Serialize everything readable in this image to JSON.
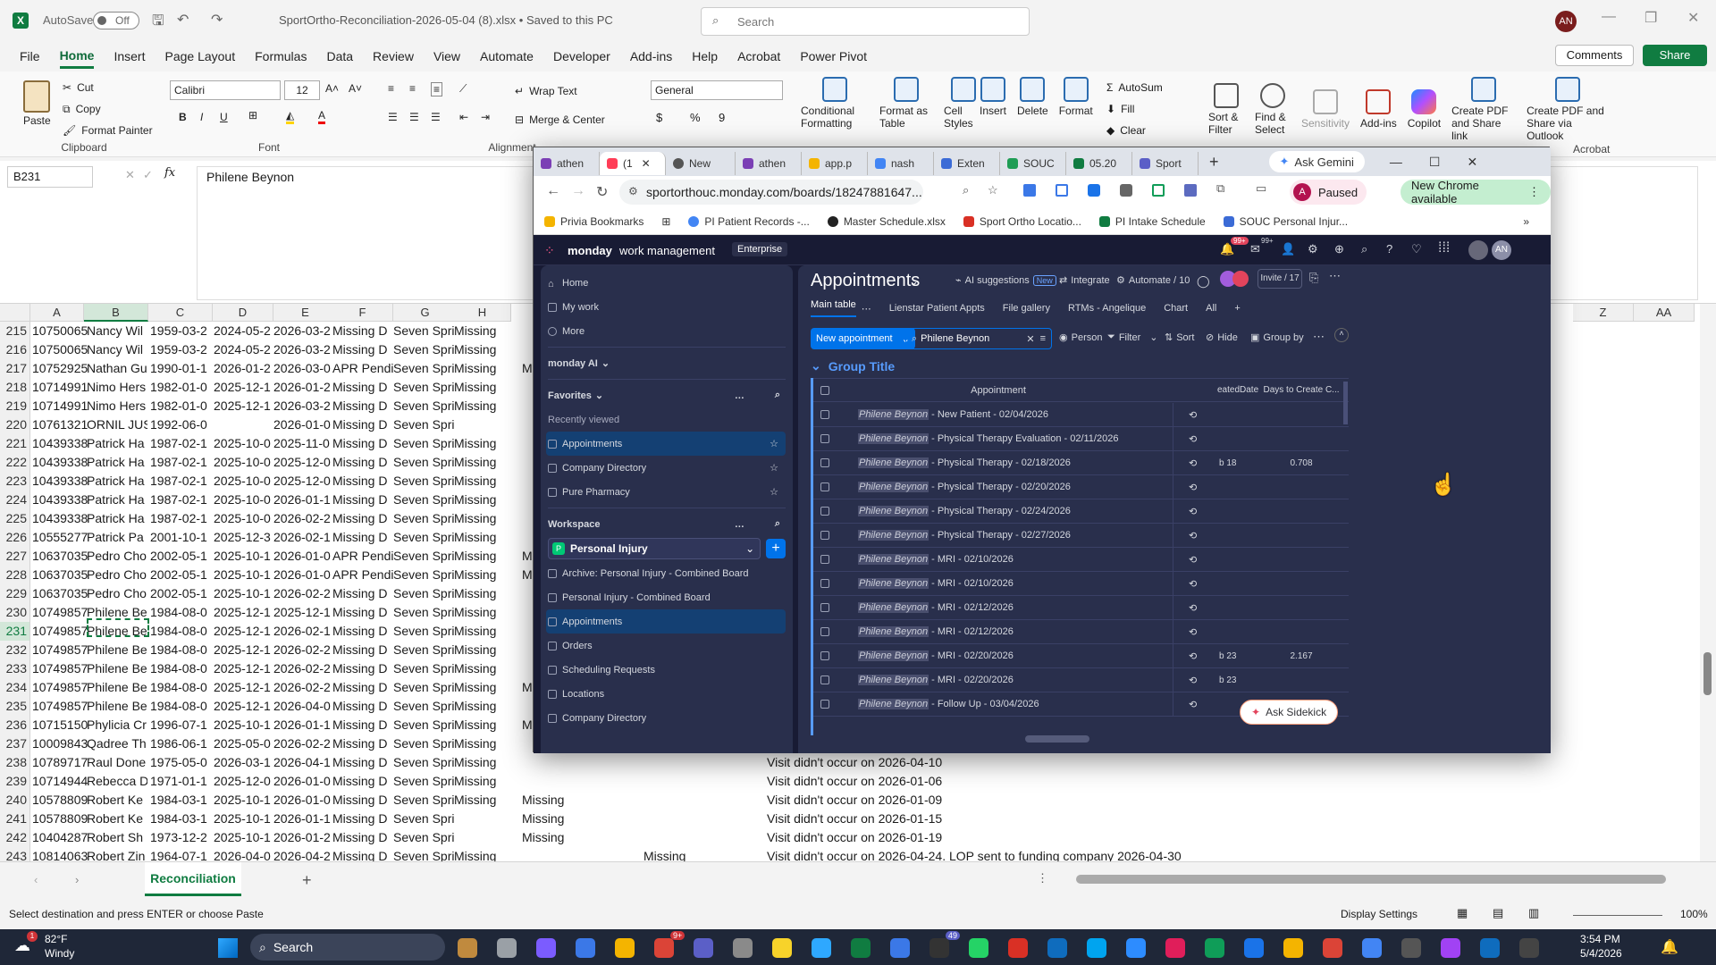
{
  "excel": {
    "autosave": "AutoSave",
    "autosave_state": "Off",
    "filename": "SportOrtho-Reconciliation-2026-05-04 (8).xlsx • Saved to this PC",
    "search_placeholder": "Search",
    "user": "AN",
    "menu": [
      "File",
      "Home",
      "Insert",
      "Page Layout",
      "Formulas",
      "Data",
      "Review",
      "View",
      "Automate",
      "Developer",
      "Add-ins",
      "Help",
      "Acrobat",
      "Power Pivot"
    ],
    "comments": "Comments",
    "share": "Share",
    "ribbon": {
      "paste": "Paste",
      "cut": "Cut",
      "copy": "Copy",
      "format_painter": "Format Painter",
      "clipboard": "Clipboard",
      "font_name": "Calibri",
      "font_size": "12",
      "font": "Font",
      "wrap": "Wrap Text",
      "merge": "Merge & Center",
      "alignment": "Alignment",
      "number_format": "General",
      "cond_fmt": "Conditional Formatting",
      "fmt_table": "Format as Table",
      "cell_styles": "Cell Styles",
      "insert": "Insert",
      "delete": "Delete",
      "format": "Format",
      "autosum": "AutoSum",
      "fill": "Fill",
      "clear": "Clear",
      "sort": "Sort & Filter",
      "find": "Find & Select",
      "sensitivity": "Sensitivity",
      "addins": "Add-ins",
      "copilot": "Copilot",
      "pdf1": "Create PDF and Share link",
      "pdf2": "Create PDF and Share via Outlook",
      "acrobat": "Acrobat"
    },
    "namebox": "B231",
    "formula": "Philene Beynon",
    "col_headers": [
      "A",
      "B",
      "C",
      "D",
      "E",
      "F",
      "G",
      "H"
    ],
    "col_headers_right": [
      "Z",
      "AA"
    ],
    "rows": [
      {
        "n": "215",
        "a": "10750065",
        "b": "Nancy Wil",
        "c": "1959-03-2",
        "d": "2024-05-2",
        "e": "2026-03-2",
        "f": "Missing D",
        "g": "Seven Spri",
        "h": "Missing",
        "i": "",
        "j": "",
        "k": ""
      },
      {
        "n": "216",
        "a": "10750065",
        "b": "Nancy Wil",
        "c": "1959-03-2",
        "d": "2024-05-2",
        "e": "2026-03-2",
        "f": "Missing D",
        "g": "Seven Spri",
        "h": "Missing",
        "i": "",
        "j": "",
        "k": ""
      },
      {
        "n": "217",
        "a": "10752925",
        "b": "Nathan Gu",
        "c": "1990-01-1",
        "d": "2026-01-2",
        "e": "2026-03-0",
        "f": "APR Pendi",
        "g": "Seven Spri",
        "h": "Missing",
        "i": "M",
        "j": "",
        "k": ""
      },
      {
        "n": "218",
        "a": "10714991",
        "b": "Nimo Hers",
        "c": "1982-01-0",
        "d": "2025-12-1",
        "e": "2026-01-2",
        "f": "Missing D",
        "g": "Seven Spri",
        "h": "Missing",
        "i": "",
        "j": "",
        "k": ""
      },
      {
        "n": "219",
        "a": "10714991",
        "b": "Nimo Hers",
        "c": "1982-01-0",
        "d": "2025-12-1",
        "e": "2026-03-2",
        "f": "Missing D",
        "g": "Seven Spri",
        "h": "Missing",
        "i": "",
        "j": "",
        "k": ""
      },
      {
        "n": "220",
        "a": "10761321",
        "b": "ORNIL JUS",
        "c": "1992-06-0",
        "d": "",
        "e": "2026-01-0",
        "f": "Missing D",
        "g": "Seven Spri",
        "h": "",
        "i": "",
        "j": "",
        "k": ""
      },
      {
        "n": "221",
        "a": "10439338",
        "b": "Patrick Ha",
        "c": "1987-02-1",
        "d": "2025-10-0",
        "e": "2025-11-0",
        "f": "Missing D",
        "g": "Seven Spri",
        "h": "Missing",
        "i": "",
        "j": "",
        "k": ""
      },
      {
        "n": "222",
        "a": "10439338",
        "b": "Patrick Ha",
        "c": "1987-02-1",
        "d": "2025-10-0",
        "e": "2025-12-0",
        "f": "Missing D",
        "g": "Seven Spri",
        "h": "Missing",
        "i": "",
        "j": "",
        "k": ""
      },
      {
        "n": "223",
        "a": "10439338",
        "b": "Patrick Ha",
        "c": "1987-02-1",
        "d": "2025-10-0",
        "e": "2025-12-0",
        "f": "Missing D",
        "g": "Seven Spri",
        "h": "Missing",
        "i": "",
        "j": "",
        "k": ""
      },
      {
        "n": "224",
        "a": "10439338",
        "b": "Patrick Ha",
        "c": "1987-02-1",
        "d": "2025-10-0",
        "e": "2026-01-1",
        "f": "Missing D",
        "g": "Seven Spri",
        "h": "Missing",
        "i": "",
        "j": "",
        "k": ""
      },
      {
        "n": "225",
        "a": "10439338",
        "b": "Patrick Ha",
        "c": "1987-02-1",
        "d": "2025-10-0",
        "e": "2026-02-2",
        "f": "Missing D",
        "g": "Seven Spri",
        "h": "Missing",
        "i": "",
        "j": "",
        "k": ""
      },
      {
        "n": "226",
        "a": "10555277",
        "b": "Patrick Pa",
        "c": "2001-10-1",
        "d": "2025-12-3",
        "e": "2026-02-1",
        "f": "Missing D",
        "g": "Seven Spri",
        "h": "Missing",
        "i": "",
        "j": "",
        "k": ""
      },
      {
        "n": "227",
        "a": "10637035",
        "b": "Pedro Cho",
        "c": "2002-05-1",
        "d": "2025-10-1",
        "e": "2026-01-0",
        "f": "APR Pendi",
        "g": "Seven Spri",
        "h": "Missing",
        "i": "M",
        "j": "",
        "k": ""
      },
      {
        "n": "228",
        "a": "10637035",
        "b": "Pedro Cho",
        "c": "2002-05-1",
        "d": "2025-10-1",
        "e": "2026-01-0",
        "f": "APR Pendi",
        "g": "Seven Spri",
        "h": "Missing",
        "i": "M",
        "j": "",
        "k": ""
      },
      {
        "n": "229",
        "a": "10637035",
        "b": "Pedro Cho",
        "c": "2002-05-1",
        "d": "2025-10-1",
        "e": "2026-02-2",
        "f": "Missing D",
        "g": "Seven Spri",
        "h": "Missing",
        "i": "",
        "j": "",
        "k": ""
      },
      {
        "n": "230",
        "a": "10749857",
        "b": "Philene Be",
        "c": "1984-08-0",
        "d": "2025-12-1",
        "e": "2025-12-1",
        "f": "Missing D",
        "g": "Seven Spri",
        "h": "Missing",
        "i": "",
        "j": "",
        "k": ""
      },
      {
        "n": "231",
        "a": "10749857",
        "b": "Philene Be",
        "c": "1984-08-0",
        "d": "2025-12-1",
        "e": "2026-02-1",
        "f": "Missing D",
        "g": "Seven Spri",
        "h": "Missing",
        "i": "",
        "j": "",
        "k": ""
      },
      {
        "n": "232",
        "a": "10749857",
        "b": "Philene Be",
        "c": "1984-08-0",
        "d": "2025-12-1",
        "e": "2026-02-2",
        "f": "Missing D",
        "g": "Seven Spri",
        "h": "Missing",
        "i": "",
        "j": "",
        "k": ""
      },
      {
        "n": "233",
        "a": "10749857",
        "b": "Philene Be",
        "c": "1984-08-0",
        "d": "2025-12-1",
        "e": "2026-02-2",
        "f": "Missing D",
        "g": "Seven Spri",
        "h": "Missing",
        "i": "",
        "j": "",
        "k": ""
      },
      {
        "n": "234",
        "a": "10749857",
        "b": "Philene Be",
        "c": "1984-08-0",
        "d": "2025-12-1",
        "e": "2026-02-2",
        "f": "Missing D",
        "g": "Seven Spri",
        "h": "Missing",
        "i": "M",
        "j": "",
        "k": ""
      },
      {
        "n": "235",
        "a": "10749857",
        "b": "Philene Be",
        "c": "1984-08-0",
        "d": "2025-12-1",
        "e": "2026-04-0",
        "f": "Missing D",
        "g": "Seven Spri",
        "h": "Missing",
        "i": "",
        "j": "",
        "k": ""
      },
      {
        "n": "236",
        "a": "10715150",
        "b": "Phylicia Cr",
        "c": "1996-07-1",
        "d": "2025-10-1",
        "e": "2026-01-1",
        "f": "Missing D",
        "g": "Seven Spri",
        "h": "Missing",
        "i": "M",
        "j": "",
        "k": ""
      },
      {
        "n": "237",
        "a": "10009843",
        "b": "Qadree Th",
        "c": "1986-06-1",
        "d": "2025-05-0",
        "e": "2026-02-2",
        "f": "Missing D",
        "g": "Seven Spri",
        "h": "Missing",
        "i": "",
        "j": "",
        "k": ""
      },
      {
        "n": "238",
        "a": "10789717",
        "b": "Raul Done",
        "c": "1975-05-0",
        "d": "2026-03-1",
        "e": "2026-04-1",
        "f": "Missing D",
        "g": "Seven Spri",
        "h": "Missing",
        "i": "",
        "j": "",
        "k": "Visit didn't occur on 2026-04-10"
      },
      {
        "n": "239",
        "a": "10714944",
        "b": "Rebecca D",
        "c": "1971-01-1",
        "d": "2025-12-0",
        "e": "2026-01-0",
        "f": "Missing D",
        "g": "Seven Spri",
        "h": "Missing",
        "i": "",
        "j": "",
        "k": "Visit didn't occur on 2026-01-06"
      },
      {
        "n": "240",
        "a": "10578809",
        "b": "Robert Ke",
        "c": "1984-03-1",
        "d": "2025-10-1",
        "e": "2026-01-0",
        "f": "Missing D",
        "g": "Seven Spri",
        "h": "Missing",
        "i": "Missing",
        "j": "",
        "k": "Visit didn't occur on 2026-01-09"
      },
      {
        "n": "241",
        "a": "10578809",
        "b": "Robert Ke",
        "c": "1984-03-1",
        "d": "2025-10-1",
        "e": "2026-01-1",
        "f": "Missing D",
        "g": "Seven Spri",
        "h": "",
        "i": "Missing",
        "j": "",
        "k": "Visit didn't occur on 2026-01-15"
      },
      {
        "n": "242",
        "a": "10404287",
        "b": "Robert Sh",
        "c": "1973-12-2",
        "d": "2025-10-1",
        "e": "2026-01-2",
        "f": "Missing D",
        "g": "Seven Spri",
        "h": "",
        "i": "Missing",
        "j": "",
        "k": "Visit didn't occur on 2026-01-19"
      },
      {
        "n": "243",
        "a": "10814063",
        "b": "Robert Zin",
        "c": "1964-07-1",
        "d": "2026-04-0",
        "e": "2026-04-2",
        "f": "Missing D",
        "g": "Seven Spri",
        "h": "Missing",
        "i": "",
        "j": "Missing",
        "k": "Visit didn't occur on 2026-04-24. LOP sent to funding company 2026-04-30"
      }
    ],
    "sheet_tab": "Reconciliation",
    "status_left": "Select destination and press ENTER or choose Paste",
    "display_settings": "Display Settings",
    "zoom": "100%"
  },
  "chrome": {
    "tabs": [
      "athen",
      "(1",
      "New",
      "athen",
      "app.p",
      "nash",
      "Exten",
      "SOUC",
      "05.20",
      "Sport"
    ],
    "ask_gemini": "Ask Gemini",
    "url": "sportorthouc.monday.com/boards/18247881647...",
    "profile_state": "Paused",
    "update": "New Chrome available",
    "bookmarks": [
      "Privia Bookmarks",
      "PI Patient Records -...",
      "Master Schedule.xlsx",
      "Sport Ortho Locatio...",
      "PI Intake Schedule",
      "SOUC Personal Injur..."
    ]
  },
  "monday": {
    "brand": "monday",
    "brand_sub": "work management",
    "plan": "Enterprise",
    "notif_count": "99+",
    "inbox_count": "99+",
    "avatar": "AN",
    "side": {
      "home": "Home",
      "mywork": "My work",
      "more": "More",
      "ai": "monday AI",
      "favorites": "Favorites",
      "recent": "Recently viewed",
      "recent_items": [
        "Appointments",
        "Company Directory",
        "Pure Pharmacy"
      ],
      "workspace": "Workspace",
      "workspace_name": "Personal Injury",
      "workspace_letter": "P",
      "ws_items": [
        "Archive: Personal Injury - Combined Board",
        "Personal Injury - Combined Board",
        "Appointments",
        "Orders",
        "Scheduling Requests",
        "Locations",
        "Company Directory"
      ]
    },
    "board": {
      "title": "Appointments",
      "ai": "AI suggestions",
      "ai_badge": "New",
      "integrate": "Integrate",
      "automate": "Automate / 10",
      "invite": "Invite / 17",
      "views": [
        "Main table",
        "Lienstar Patient Appts",
        "File gallery",
        "RTMs - Angelique",
        "Chart",
        "All"
      ],
      "new_btn": "New appointment",
      "search_value": "Philene Beynon",
      "person": "Person",
      "filter": "Filter",
      "sort": "Sort",
      "hide": "Hide",
      "group": "Group by",
      "group_title": "Group Title",
      "col_appt": "Appointment",
      "col_created": "eatedDate",
      "col_days": "Days to Create C...",
      "rows": [
        {
          "name": "Philene Beynon",
          "rest": " - New Patient - 02/04/2026",
          "created": "",
          "days": ""
        },
        {
          "name": "Philene Beynon",
          "rest": " - Physical Therapy Evaluation - 02/11/2026",
          "created": "",
          "days": ""
        },
        {
          "name": "Philene Beynon",
          "rest": " - Physical Therapy - 02/18/2026",
          "created": "b 18",
          "days": "0.708"
        },
        {
          "name": "Philene Beynon",
          "rest": " - Physical Therapy - 02/20/2026",
          "created": "",
          "days": ""
        },
        {
          "name": "Philene Beynon",
          "rest": " - Physical Therapy - 02/24/2026",
          "created": "",
          "days": ""
        },
        {
          "name": "Philene Beynon",
          "rest": " - Physical Therapy - 02/27/2026",
          "created": "",
          "days": ""
        },
        {
          "name": "Philene Beynon",
          "rest": " - MRI - 02/10/2026",
          "created": "",
          "days": ""
        },
        {
          "name": "Philene Beynon",
          "rest": " - MRI - 02/10/2026",
          "created": "",
          "days": ""
        },
        {
          "name": "Philene Beynon",
          "rest": " - MRI - 02/12/2026",
          "created": "",
          "days": ""
        },
        {
          "name": "Philene Beynon",
          "rest": " - MRI - 02/12/2026",
          "created": "",
          "days": ""
        },
        {
          "name": "Philene Beynon",
          "rest": " - MRI - 02/20/2026",
          "created": "b 23",
          "days": "2.167"
        },
        {
          "name": "Philene Beynon",
          "rest": " - MRI - 02/20/2026",
          "created": "b 23",
          "days": ""
        },
        {
          "name": "Philene Beynon",
          "rest": " - Follow Up - 03/04/2026",
          "created": "",
          "days": ""
        }
      ],
      "sidekick": "Ask Sidekick"
    }
  },
  "taskbar": {
    "temp": "82°F",
    "weather": "Windy",
    "alert": "1",
    "search": "Search",
    "time": "3:54 PM",
    "date": "5/4/2026",
    "badge_teams": "9+",
    "badge_whatsapp": "49"
  }
}
